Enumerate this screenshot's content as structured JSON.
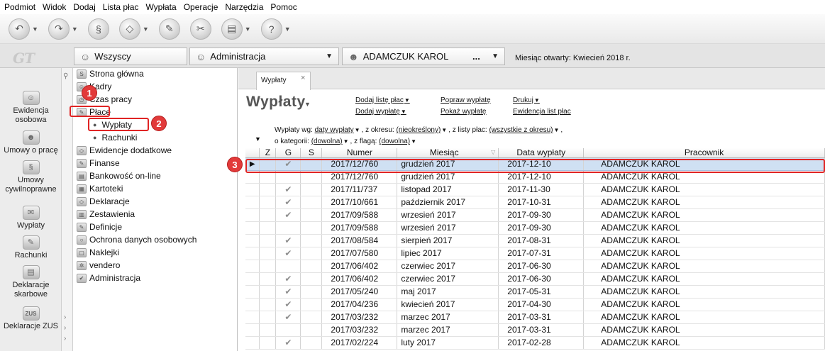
{
  "menubar": [
    "Podmiot",
    "Widok",
    "Dodaj",
    "Lista płac",
    "Wypłata",
    "Operacje",
    "Narzędzia",
    "Pomoc"
  ],
  "toolbar": {
    "buttons": [
      {
        "icon": "back-icon",
        "has_dropdown": true
      },
      {
        "icon": "forward-icon",
        "has_dropdown": true
      },
      {
        "icon": "stamp-icon",
        "has_dropdown": false
      },
      {
        "icon": "eraser-icon",
        "has_dropdown": true
      },
      {
        "icon": "tools-icon",
        "has_dropdown": false
      },
      {
        "icon": "scissors-icon",
        "has_dropdown": false
      },
      {
        "icon": "printer-icon",
        "has_dropdown": true
      },
      {
        "icon": "help-icon",
        "has_dropdown": true
      }
    ]
  },
  "tabrow": {
    "logo": "GT",
    "group": "Wszyscy",
    "department": "Administracja",
    "employee": "ADAMCZUK KAROL",
    "employee_more": "...",
    "month_open": "Miesiąc otwarty: Kwiecień 2018 r."
  },
  "leftcol": [
    {
      "label": "Ewidencja osobowa",
      "icon": "people-icon"
    },
    {
      "label": "Umowy o pracę",
      "icon": "contract-icon"
    },
    {
      "label": "Umowy cywilnoprawne",
      "icon": "civil-contract-icon"
    },
    {
      "label": "Wypłaty",
      "icon": "payout-icon"
    },
    {
      "label": "Rachunki",
      "icon": "bill-icon"
    },
    {
      "label": "Deklaracje skarbowe",
      "icon": "tax-declaration-icon"
    },
    {
      "label": "Deklaracje ZUS",
      "icon": "zus-icon"
    }
  ],
  "zus_badge": "ZUS",
  "tree": {
    "items": [
      {
        "label": "Strona główna",
        "icon": "home-icon"
      },
      {
        "label": "Kadry",
        "icon": "hr-icon"
      },
      {
        "label": "Czas pracy",
        "icon": "clock-icon"
      },
      {
        "label": "Płace",
        "icon": "wages-icon"
      },
      {
        "label": "Wypłaty",
        "icon": "bullet"
      },
      {
        "label": "Rachunki",
        "icon": "bullet"
      },
      {
        "label": "Ewidencje dodatkowe",
        "icon": "records-icon"
      },
      {
        "label": "Finanse",
        "icon": "finance-icon"
      },
      {
        "label": "Bankowość on-line",
        "icon": "bank-icon"
      },
      {
        "label": "Kartoteki",
        "icon": "cards-icon"
      },
      {
        "label": "Deklaracje",
        "icon": "declaration-icon"
      },
      {
        "label": "Zestawienia",
        "icon": "report-icon"
      },
      {
        "label": "Definicje",
        "icon": "definitions-icon"
      },
      {
        "label": "Ochrona danych osobowych",
        "icon": "privacy-icon"
      },
      {
        "label": "Naklejki",
        "icon": "sticker-icon"
      },
      {
        "label": "vendero",
        "icon": "vendero-icon"
      },
      {
        "label": "Administracja",
        "icon": "admin-icon"
      }
    ]
  },
  "callouts": [
    "1",
    "2",
    "3"
  ],
  "colors": {
    "highlight": "#e02424",
    "callout": "#e23a3a",
    "selected_row": "#cfe0f3"
  },
  "main": {
    "tab_label": "Wypłaty",
    "tab_close": "×",
    "title": "Wypłaty",
    "actions": [
      {
        "label": "Dodaj listę płac",
        "dropdown": true
      },
      {
        "label": "Dodaj wypłatę",
        "dropdown": true
      },
      {
        "label": "Popraw wypłatę",
        "dropdown": false
      },
      {
        "label": "Pokaż wypłatę",
        "dropdown": false
      },
      {
        "label": "Drukuj",
        "dropdown": true
      },
      {
        "label": "Ewidencja list płac",
        "dropdown": false
      }
    ],
    "filters": {
      "by_label": "Wypłaty wg:",
      "by_value": "daty wypłaty",
      "period_label": ", z okresu:",
      "period_value": "(nieokreślony)",
      "list_label": ", z listy płac:",
      "list_value": "(wszystkie z okresu)",
      "category_label": "o kategorii:",
      "category_value": "(dowolna)",
      "flag_label": ", z flagą:",
      "flag_value": "(dowolna)"
    }
  },
  "table": {
    "headers": [
      "",
      "Z",
      "G",
      "S",
      "Numer",
      "Miesiąc",
      "Data wypłaty",
      "Pracownik"
    ],
    "rows": [
      {
        "z": "",
        "g": "✔",
        "s": "",
        "numer": "2017/12/760",
        "miesiac": "grudzień 2017",
        "data": "2017-12-10",
        "pracownik": "ADAMCZUK KAROL",
        "selected": true
      },
      {
        "z": "",
        "g": "",
        "s": "",
        "numer": "2017/12/760",
        "miesiac": "grudzień 2017",
        "data": "2017-12-10",
        "pracownik": "ADAMCZUK KAROL"
      },
      {
        "z": "",
        "g": "✔",
        "s": "",
        "numer": "2017/11/737",
        "miesiac": "listopad 2017",
        "data": "2017-11-30",
        "pracownik": "ADAMCZUK KAROL"
      },
      {
        "z": "",
        "g": "✔",
        "s": "",
        "numer": "2017/10/661",
        "miesiac": "październik 2017",
        "data": "2017-10-31",
        "pracownik": "ADAMCZUK KAROL"
      },
      {
        "z": "",
        "g": "✔",
        "s": "",
        "numer": "2017/09/588",
        "miesiac": "wrzesień 2017",
        "data": "2017-09-30",
        "pracownik": "ADAMCZUK KAROL"
      },
      {
        "z": "",
        "g": "",
        "s": "",
        "numer": "2017/09/588",
        "miesiac": "wrzesień 2017",
        "data": "2017-09-30",
        "pracownik": "ADAMCZUK KAROL"
      },
      {
        "z": "",
        "g": "✔",
        "s": "",
        "numer": "2017/08/584",
        "miesiac": "sierpień 2017",
        "data": "2017-08-31",
        "pracownik": "ADAMCZUK KAROL"
      },
      {
        "z": "",
        "g": "✔",
        "s": "",
        "numer": "2017/07/580",
        "miesiac": "lipiec 2017",
        "data": "2017-07-31",
        "pracownik": "ADAMCZUK KAROL"
      },
      {
        "z": "",
        "g": "",
        "s": "",
        "numer": "2017/06/402",
        "miesiac": "czerwiec 2017",
        "data": "2017-06-30",
        "pracownik": "ADAMCZUK KAROL"
      },
      {
        "z": "",
        "g": "✔",
        "s": "",
        "numer": "2017/06/402",
        "miesiac": "czerwiec 2017",
        "data": "2017-06-30",
        "pracownik": "ADAMCZUK KAROL"
      },
      {
        "z": "",
        "g": "✔",
        "s": "",
        "numer": "2017/05/240",
        "miesiac": "maj 2017",
        "data": "2017-05-31",
        "pracownik": "ADAMCZUK KAROL"
      },
      {
        "z": "",
        "g": "✔",
        "s": "",
        "numer": "2017/04/236",
        "miesiac": "kwiecień 2017",
        "data": "2017-04-30",
        "pracownik": "ADAMCZUK KAROL"
      },
      {
        "z": "",
        "g": "✔",
        "s": "",
        "numer": "2017/03/232",
        "miesiac": "marzec 2017",
        "data": "2017-03-31",
        "pracownik": "ADAMCZUK KAROL"
      },
      {
        "z": "",
        "g": "",
        "s": "",
        "numer": "2017/03/232",
        "miesiac": "marzec 2017",
        "data": "2017-03-31",
        "pracownik": "ADAMCZUK KAROL"
      },
      {
        "z": "",
        "g": "✔",
        "s": "",
        "numer": "2017/02/224",
        "miesiac": "luty 2017",
        "data": "2017-02-28",
        "pracownik": "ADAMCZUK KAROL"
      }
    ]
  }
}
